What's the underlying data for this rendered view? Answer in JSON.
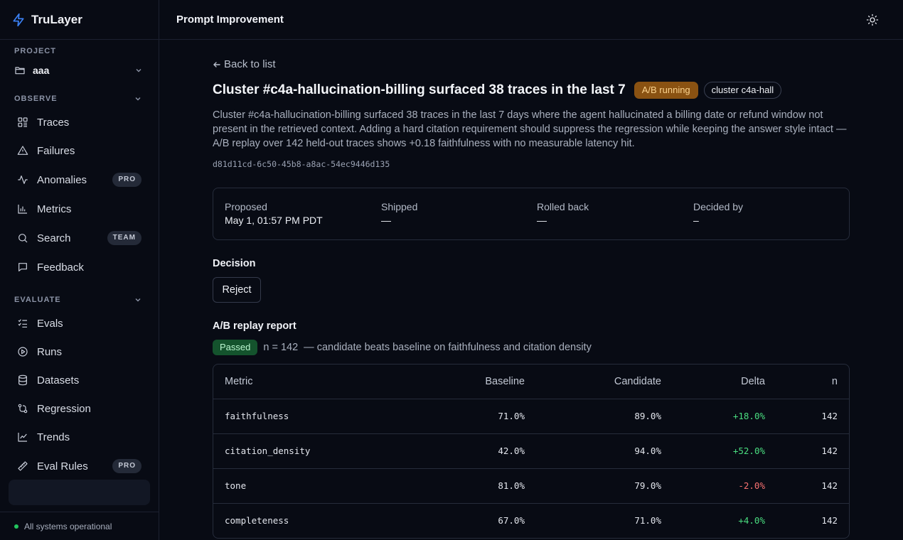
{
  "brand": {
    "name": "TruLayer"
  },
  "sidebar": {
    "project_label": "PROJECT",
    "project_name": "aaa",
    "observe_label": "OBSERVE",
    "observe_items": [
      {
        "label": "Traces",
        "icon": "traces-icon"
      },
      {
        "label": "Failures",
        "icon": "warning-icon"
      },
      {
        "label": "Anomalies",
        "icon": "activity-icon",
        "badge": "PRO"
      },
      {
        "label": "Metrics",
        "icon": "bar-chart-icon"
      },
      {
        "label": "Search",
        "icon": "search-icon",
        "badge": "TEAM"
      },
      {
        "label": "Feedback",
        "icon": "message-icon"
      }
    ],
    "evaluate_label": "EVALUATE",
    "evaluate_items": [
      {
        "label": "Evals",
        "icon": "checklist-icon"
      },
      {
        "label": "Runs",
        "icon": "play-icon"
      },
      {
        "label": "Datasets",
        "icon": "database-icon"
      },
      {
        "label": "Regression",
        "icon": "git-compare-icon"
      },
      {
        "label": "Trends",
        "icon": "trend-icon"
      },
      {
        "label": "Eval Rules",
        "icon": "ruler-icon",
        "badge": "PRO"
      }
    ],
    "status_text": "All systems operational"
  },
  "header": {
    "title": "Prompt Improvement"
  },
  "main": {
    "back_label": "Back to list",
    "title": "Cluster #c4a-hallucination-billing surfaced 38 traces in the last 7",
    "status_chip": "A/B running",
    "cluster_chip": "cluster c4a-hall",
    "description": "Cluster #c4a-hallucination-billing surfaced 38 traces in the last 7 days where the agent hallucinated a billing date or refund window not present in the retrieved context. Adding a hard citation requirement should suppress the regression while keeping the answer style intact — A/B replay over 142 held-out traces shows +0.18 faithfulness with no measurable latency hit.",
    "id": "d81d11cd-6c50-45b8-a8ac-54ec9446d135",
    "timeline": {
      "proposed_label": "Proposed",
      "proposed_value": "May 1, 01:57 PM PDT",
      "shipped_label": "Shipped",
      "shipped_value": "—",
      "rolled_back_label": "Rolled back",
      "rolled_back_value": "—",
      "decided_by_label": "Decided by",
      "decided_by_value": "–"
    },
    "decision_label": "Decision",
    "reject_label": "Reject",
    "report_label": "A/B replay report",
    "report_status": "Passed",
    "report_n": "n = 142",
    "report_summary": "— candidate beats baseline on faithfulness and citation density",
    "table": {
      "headers": {
        "metric": "Metric",
        "baseline": "Baseline",
        "candidate": "Candidate",
        "delta": "Delta",
        "n": "n"
      },
      "rows": [
        {
          "metric": "faithfulness",
          "baseline": "71.0%",
          "candidate": "89.0%",
          "delta": "+18.0%",
          "n": "142"
        },
        {
          "metric": "citation_density",
          "baseline": "42.0%",
          "candidate": "94.0%",
          "delta": "+52.0%",
          "n": "142"
        },
        {
          "metric": "tone",
          "baseline": "81.0%",
          "candidate": "79.0%",
          "delta": "-2.0%",
          "n": "142"
        },
        {
          "metric": "completeness",
          "baseline": "67.0%",
          "candidate": "71.0%",
          "delta": "+4.0%",
          "n": "142"
        }
      ]
    }
  },
  "colors": {
    "accent": "#3b82f6",
    "positive": "#4ade80",
    "negative": "#f87171",
    "warning_chip": "#8a5212",
    "passed": "#14532d"
  }
}
